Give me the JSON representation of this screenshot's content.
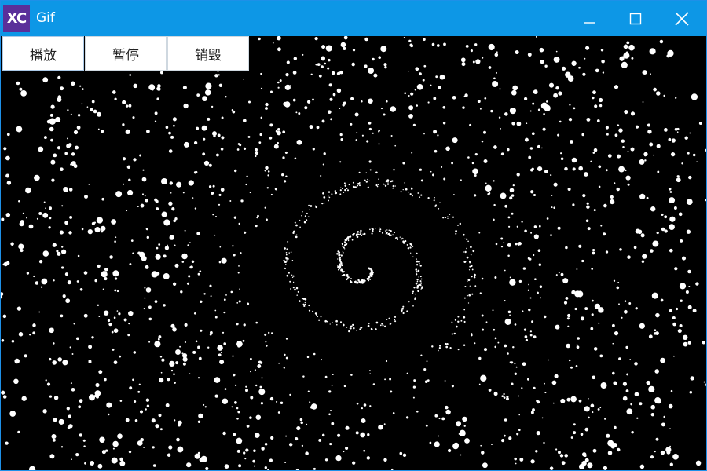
{
  "window": {
    "title": "Gif",
    "logo_text": "XC",
    "logo_color": "#5a2f9a",
    "titlebar_color": "#0d97e6"
  },
  "controls": {
    "minimize_icon": "minimize-icon",
    "maximize_icon": "maximize-icon",
    "close_icon": "close-icon"
  },
  "toolbar": {
    "play_label": "播放",
    "pause_label": "暂停",
    "destroy_label": "销毁"
  },
  "animation": {
    "background_color": "#000000",
    "particle_color": "#ffffff"
  }
}
